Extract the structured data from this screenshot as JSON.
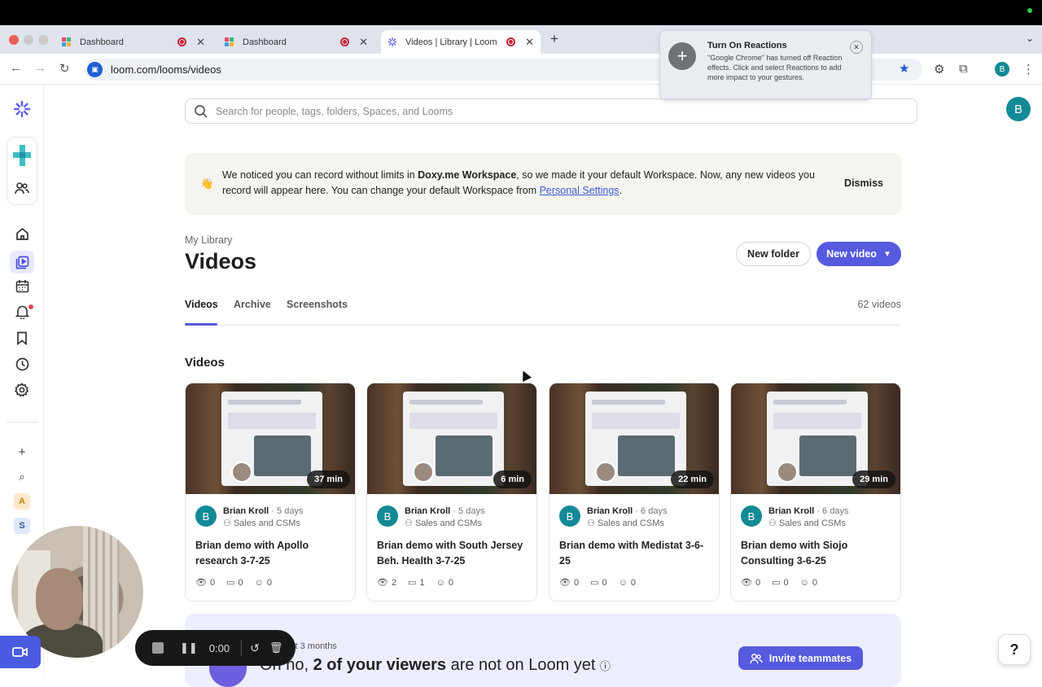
{
  "browser": {
    "tabs": [
      {
        "title": "Dashboard",
        "active": false
      },
      {
        "title": "Dashboard",
        "active": false
      },
      {
        "title": "Videos | Library | Loom",
        "active": true
      }
    ],
    "url": "loom.com/looms/videos",
    "profile_initial": "B"
  },
  "popup": {
    "title": "Turn On Reactions",
    "body": "\"Google Chrome\" has turned off Reaction effects. Click  and select Reactions to add more impact to your gestures."
  },
  "search": {
    "placeholder": "Search for people, tags, folders, Spaces, and Looms"
  },
  "user_initial": "B",
  "banner": {
    "emoji": "👋",
    "text_1": "We noticed you can record without limits in ",
    "workspace": "Doxy.me Workspace",
    "text_2": ", so we made it your default Workspace. Now, any new videos you record will appear here. You can change your default Workspace from ",
    "link": "Personal Settings",
    "text_3": ".",
    "dismiss": "Dismiss"
  },
  "library": {
    "breadcrumb": "My Library",
    "title": "Videos",
    "new_folder": "New folder",
    "new_video": "New video",
    "tabs": [
      "Videos",
      "Archive",
      "Screenshots"
    ],
    "count": "62 videos",
    "section": "Videos"
  },
  "videos": [
    {
      "duration": "37 min",
      "author": "Brian Kroll",
      "ago": "5 days",
      "space": "Sales and CSMs",
      "title": "Brian demo with Apollo research 3-7-25",
      "views": "0",
      "comments": "0",
      "reactions": "0"
    },
    {
      "duration": "6 min",
      "author": "Brian Kroll",
      "ago": "5 days",
      "space": "Sales and CSMs",
      "title": "Brian demo with South Jersey Beh. Health 3-7-25",
      "views": "2",
      "comments": "1",
      "reactions": "0"
    },
    {
      "duration": "22 min",
      "author": "Brian Kroll",
      "ago": "6 days",
      "space": "Sales and CSMs",
      "title": "Brian demo with Medistat 3-6-25",
      "views": "0",
      "comments": "0",
      "reactions": "0"
    },
    {
      "duration": "29 min",
      "author": "Brian Kroll",
      "ago": "6 days",
      "space": "Sales and CSMs",
      "title": "Brian demo with Siojo Consulting 3-6-25",
      "views": "0",
      "comments": "0",
      "reactions": "0"
    }
  ],
  "promo": {
    "since": "st 3 months",
    "head_1": "Oh no, ",
    "head_bold": "2 of your viewers",
    "head_2": " are not on Loom yet",
    "invite": "Invite teammates"
  },
  "recorder": {
    "time": "0:00"
  },
  "sidebar": {
    "letters": [
      "A",
      "S"
    ]
  },
  "help": "?",
  "colors": {
    "accent": "#565ade",
    "avatar": "#138a96",
    "banner_bg": "#f6f4ee"
  }
}
